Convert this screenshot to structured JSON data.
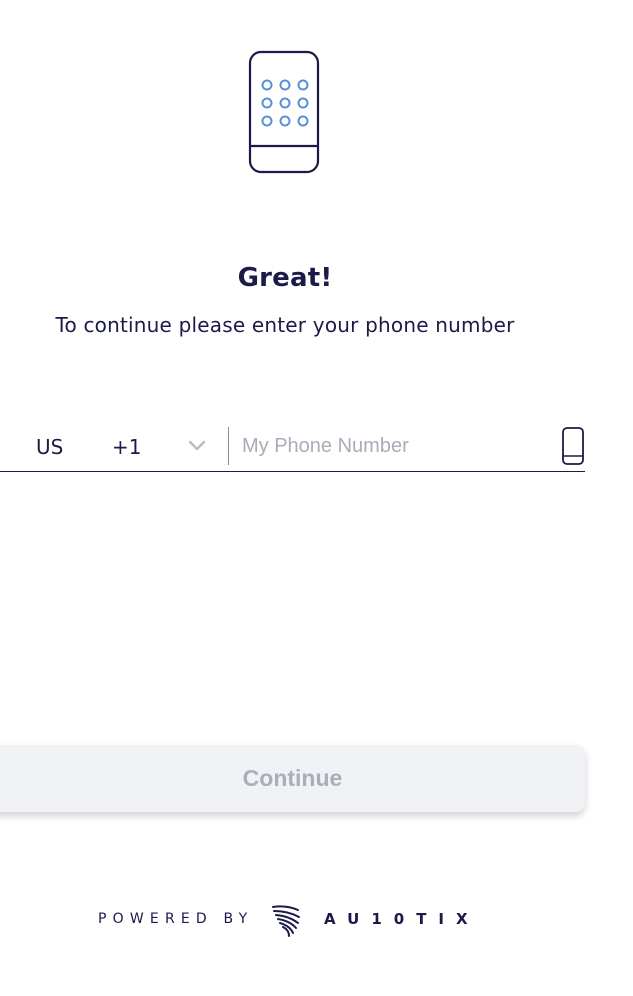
{
  "header": {
    "title": "Great!",
    "subtitle": "To continue please enter your phone number"
  },
  "phone_form": {
    "country": "US",
    "dial_code": "+1",
    "phone_value": "",
    "phone_placeholder": "My Phone Number"
  },
  "actions": {
    "continue_label": "Continue"
  },
  "footer": {
    "powered_by": "POWERED BY",
    "brand": "AU10TIX"
  },
  "icons": {
    "hero": "phone-keypad-icon",
    "country_dropdown": "chevron-down-icon",
    "input_adornment": "mobile-phone-icon",
    "brand_mark": "au10tix-logo-icon"
  },
  "colors": {
    "primary_text": "#1b1a48",
    "accent_blue": "#5b8fd6",
    "button_bg": "#f1f2f6",
    "button_text_disabled": "#a9aeb9",
    "placeholder": "#a8adb8"
  }
}
